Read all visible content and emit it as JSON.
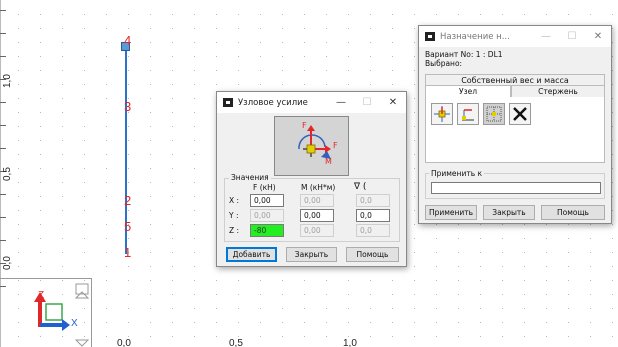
{
  "canvas": {
    "y_ticks": [
      "1,0",
      "0,5",
      "0,0"
    ],
    "x_ticks": [
      "0,0",
      "0,5",
      "1,0"
    ],
    "node_labels": [
      "4",
      "3",
      "2",
      "5",
      "1"
    ],
    "triad": {
      "z": "Z",
      "x": "X"
    },
    "colors": {
      "member": "#2a73c6",
      "node_label": "#e0282a",
      "triad_z": "#e0282a",
      "triad_x": "#2060d0"
    }
  },
  "nodal_force_dialog": {
    "title": "Узловое усилие",
    "diagram_labels": {
      "f_top": "F",
      "f_right": "F",
      "m": "M"
    },
    "group_label": "Значения",
    "col_headers": [
      "F (кН)",
      "M (кН*м)",
      "∇ ("
    ],
    "rows": [
      {
        "axis": "X :",
        "f": "0,00",
        "m": "0,00",
        "r": "0,0"
      },
      {
        "axis": "Y :",
        "f": "0,00",
        "m": "0,00",
        "r": "0,0"
      },
      {
        "axis": "Z :",
        "f": "-80",
        "m": "0,00",
        "r": "0,0"
      }
    ],
    "buttons": {
      "add": "Добавить",
      "close": "Закрыть",
      "help": "Помощь"
    }
  },
  "assign_dialog": {
    "title": "Назначение н...",
    "variant_text": "Вариант No: 1 : DL1",
    "selected_text": "Выбрано:",
    "section_label": "Собственный вес и масса",
    "tabs": [
      "Узел",
      "Стержень"
    ],
    "tools": [
      "node-load-icon",
      "support-load-icon",
      "grid-load-icon",
      "delete-icon"
    ],
    "apply_to_label": "Применить к",
    "apply_to_value": "",
    "buttons": {
      "apply": "Применить",
      "close": "Закрыть",
      "help": "Помощь"
    }
  }
}
